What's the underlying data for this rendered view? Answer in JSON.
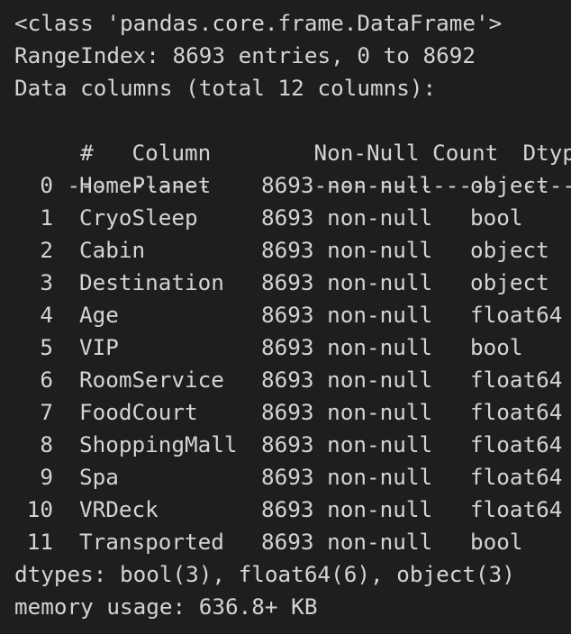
{
  "header": {
    "class_line": "<class 'pandas.core.frame.DataFrame'>",
    "range_index": "RangeIndex: 8693 entries, 0 to 8692",
    "data_columns": "Data columns (total 12 columns):"
  },
  "table": {
    "headers": {
      "index": " #",
      "column": "Column",
      "count": "Non-Null Count",
      "dtype": "Dtype"
    },
    "separators": {
      "index": "---",
      "column": "------",
      "count": "--------------",
      "dtype": "-----"
    },
    "rows": [
      {
        "index": "0",
        "column": "HomePlanet",
        "count": "8693 non-null",
        "dtype": "object"
      },
      {
        "index": "1",
        "column": "CryoSleep",
        "count": "8693 non-null",
        "dtype": "bool"
      },
      {
        "index": "2",
        "column": "Cabin",
        "count": "8693 non-null",
        "dtype": "object"
      },
      {
        "index": "3",
        "column": "Destination",
        "count": "8693 non-null",
        "dtype": "object"
      },
      {
        "index": "4",
        "column": "Age",
        "count": "8693 non-null",
        "dtype": "float64"
      },
      {
        "index": "5",
        "column": "VIP",
        "count": "8693 non-null",
        "dtype": "bool"
      },
      {
        "index": "6",
        "column": "RoomService",
        "count": "8693 non-null",
        "dtype": "float64"
      },
      {
        "index": "7",
        "column": "FoodCourt",
        "count": "8693 non-null",
        "dtype": "float64"
      },
      {
        "index": "8",
        "column": "ShoppingMall",
        "count": "8693 non-null",
        "dtype": "float64"
      },
      {
        "index": "9",
        "column": "Spa",
        "count": "8693 non-null",
        "dtype": "float64"
      },
      {
        "index": "10",
        "column": "VRDeck",
        "count": "8693 non-null",
        "dtype": "float64"
      },
      {
        "index": "11",
        "column": "Transported",
        "count": "8693 non-null",
        "dtype": "bool"
      }
    ]
  },
  "footer": {
    "dtypes": "dtypes: bool(3), float64(6), object(3)",
    "memory": "memory usage: 636.8+ KB"
  }
}
